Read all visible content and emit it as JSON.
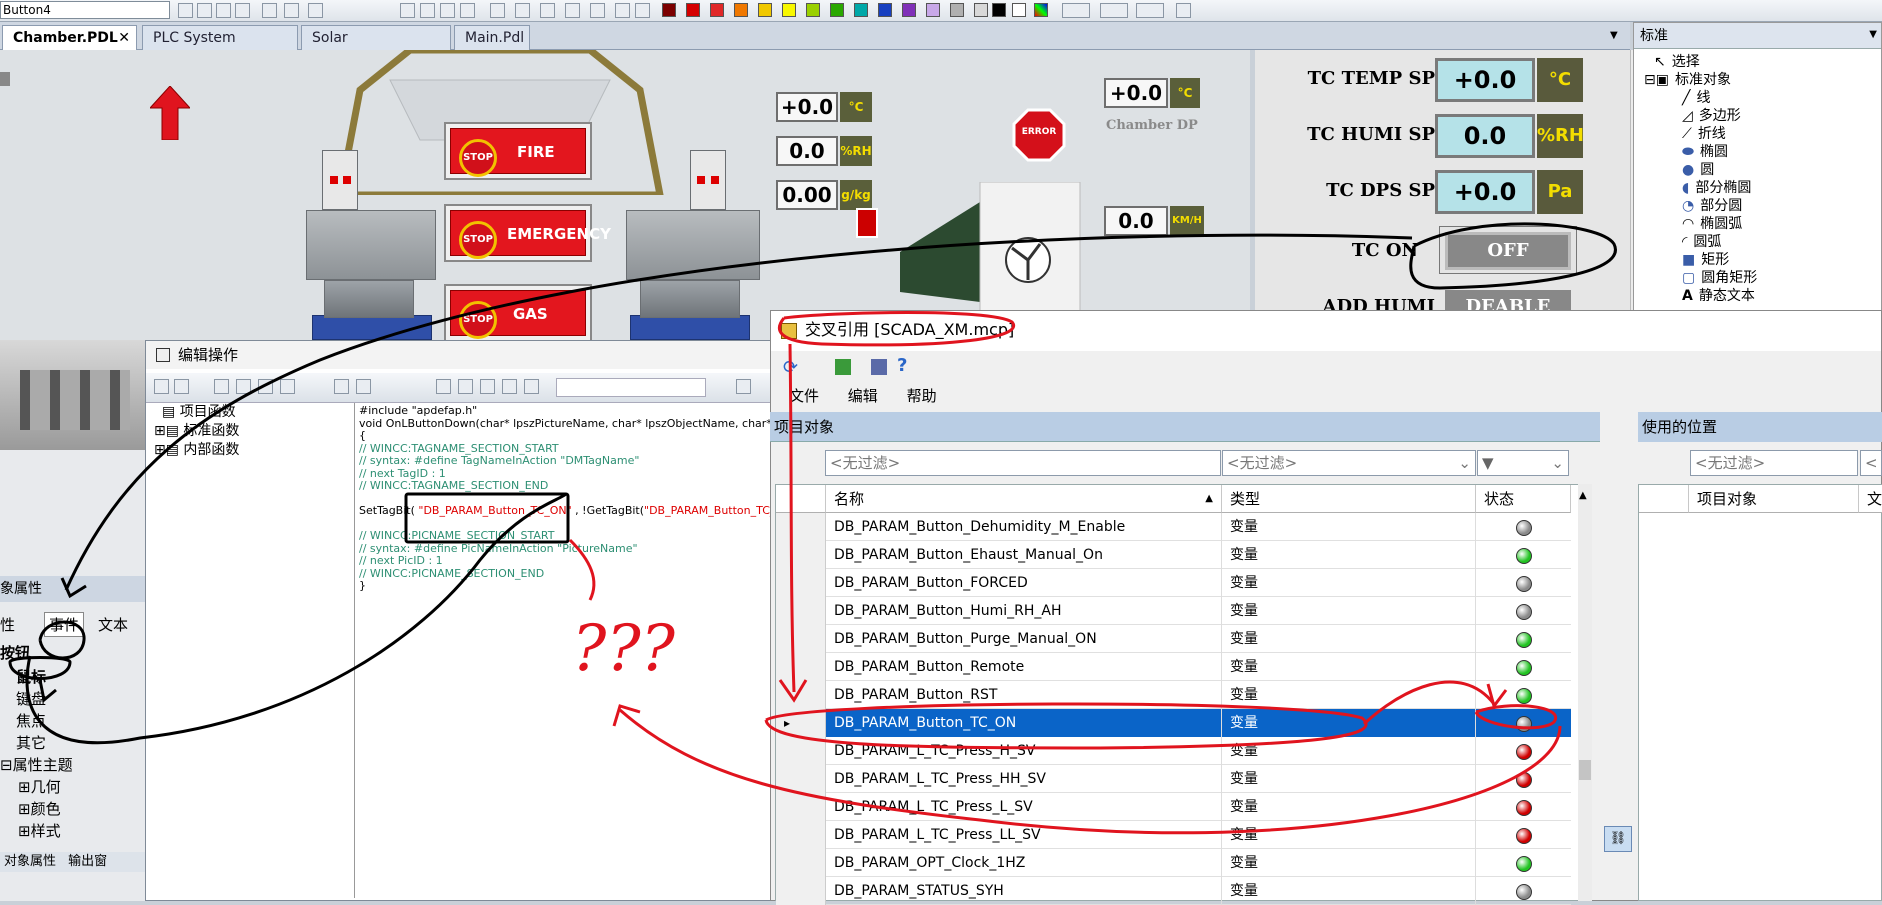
{
  "toolbar": {
    "object_selector": "Button4"
  },
  "tabs": [
    "Chamber.PDL",
    "PLC System Time.Pdl",
    "Solar simulation.PDL",
    "Main.Pdl"
  ],
  "tab_close": "✕",
  "canvas": {
    "buttons": {
      "fire": "FIRE",
      "emergency": "EMERGENCY",
      "gas": "GAS Alarm",
      "stop": "STOP"
    },
    "error_sign": "ERROR",
    "values": [
      {
        "v": "+0.0",
        "u": "°C"
      },
      {
        "v": "0.0",
        "u": "%RH"
      },
      {
        "v": "0.00",
        "u": "g/kg"
      }
    ],
    "chamber_dp": {
      "v": "+0.0",
      "u": "°C",
      "label": "Chamber DP"
    },
    "wind": {
      "v": "0.0",
      "u": "KM/H"
    }
  },
  "panel": {
    "tc_temp_sp": {
      "label": "TC TEMP SP",
      "value": "+0.0",
      "unit": "°C"
    },
    "tc_humi_sp": {
      "label": "TC HUMI SP",
      "value": "0.0",
      "unit": "%RH"
    },
    "tc_dps_sp": {
      "label": "TC DPS SP",
      "value": "+0.0",
      "unit": "Pa"
    },
    "tc_on": {
      "label": "TC ON",
      "button": "OFF"
    },
    "add_humi": {
      "label": "ADD HUMI",
      "button": "DEABLE"
    }
  },
  "toolbox": {
    "header": "标准",
    "items": [
      "选择",
      "标准对象",
      "线",
      "多边形",
      "折线",
      "椭圆",
      "圆",
      "部分椭圆",
      "部分圆",
      "椭圆弧",
      "圆弧",
      "矩形",
      "圆角矩形",
      "静态文本"
    ]
  },
  "leftpanel": {
    "title": "象属性",
    "tabs": [
      "性",
      "事件",
      "文本"
    ],
    "items": [
      "按钮",
      "鼠标",
      "键盘",
      "焦点",
      "其它",
      "属性主题",
      "几何",
      "颜色",
      "样式"
    ],
    "bottom_tabs": [
      "对象属性",
      "输出窗"
    ]
  },
  "editor": {
    "title": "编辑操作",
    "tree": [
      "项目函数",
      "标准函数",
      "内部函数"
    ],
    "code": [
      {
        "t": "#include \"apdefap.h\"",
        "c": "pp"
      },
      {
        "t": "void OnLButtonDown(char* lpszPictureName, char* lpszObjectName, char* lpszProperty",
        "c": "n"
      },
      {
        "t": "{",
        "c": "n"
      },
      {
        "t": "// WINCC:TAGNAME_SECTION_START",
        "c": "cm"
      },
      {
        "t": "// syntax: #define TagNameInAction \"DMTagName\"",
        "c": "cm"
      },
      {
        "t": "// next TagID : 1",
        "c": "cm"
      },
      {
        "t": "// WINCC:TAGNAME_SECTION_END",
        "c": "cm"
      },
      {
        "t": "",
        "c": "n"
      },
      {
        "t": "SetTagBit( \"DB_PARAM_Button_TC_ON\" , !GetTagBit(\"DB_PARAM_Button_TC_O",
        "c": "st"
      },
      {
        "t": "",
        "c": "n"
      },
      {
        "t": "// WINCC:PICNAME_SECTION_START",
        "c": "cm"
      },
      {
        "t": "// syntax: #define PicNameInAction \"PictureName\"",
        "c": "cm"
      },
      {
        "t": "// next PicID : 1",
        "c": "cm"
      },
      {
        "t": "// WINCC:PICNAME_SECTION_END",
        "c": "cm"
      },
      {
        "t": "}",
        "c": "n"
      }
    ]
  },
  "annotation": {
    "question": "???"
  },
  "xref": {
    "title": "交叉引用 [SCADA_XM.mcp]",
    "menu": [
      "文件",
      "编辑",
      "帮助"
    ],
    "project_objects": "项目对象",
    "used_locations": "使用的位置",
    "filter": "<无过滤>",
    "columns": [
      "名称",
      "类型",
      "状态"
    ],
    "loc_columns": [
      "项目对象",
      "文"
    ],
    "rows": [
      {
        "name": "DB_PARAM_Button_Dehumidity_M_Enable",
        "type": "变量",
        "status": "gray"
      },
      {
        "name": "DB_PARAM_Button_Ehaust_Manual_On",
        "type": "变量",
        "status": "green"
      },
      {
        "name": "DB_PARAM_Button_FORCED",
        "type": "变量",
        "status": "gray"
      },
      {
        "name": "DB_PARAM_Button_Humi_RH_AH",
        "type": "变量",
        "status": "gray"
      },
      {
        "name": "DB_PARAM_Button_Purge_Manual_ON",
        "type": "变量",
        "status": "green"
      },
      {
        "name": "DB_PARAM_Button_Remote",
        "type": "变量",
        "status": "green"
      },
      {
        "name": "DB_PARAM_Button_RST",
        "type": "变量",
        "status": "green"
      },
      {
        "name": "DB_PARAM_Button_TC_ON",
        "type": "变量",
        "status": "gray",
        "selected": true
      },
      {
        "name": "DB_PARAM_L_TC_Press_H_SV",
        "type": "变量",
        "status": "red"
      },
      {
        "name": "DB_PARAM_L_TC_Press_HH_SV",
        "type": "变量",
        "status": "red"
      },
      {
        "name": "DB_PARAM_L_TC_Press_L_SV",
        "type": "变量",
        "status": "red"
      },
      {
        "name": "DB_PARAM_L_TC_Press_LL_SV",
        "type": "变量",
        "status": "red"
      },
      {
        "name": "DB_PARAM_OPT_Clock_1HZ",
        "type": "变量",
        "status": "green"
      },
      {
        "name": "DB_PARAM_STATUS_SYH",
        "type": "变量",
        "status": "gray"
      }
    ],
    "status_colors": {
      "gray": "#8a8a8a",
      "green": "#22c322",
      "red": "#d00000"
    }
  },
  "colors": {
    "annotation_red": "#e0141e",
    "annotation_black": "#000000",
    "selection": "#0a64c8"
  }
}
